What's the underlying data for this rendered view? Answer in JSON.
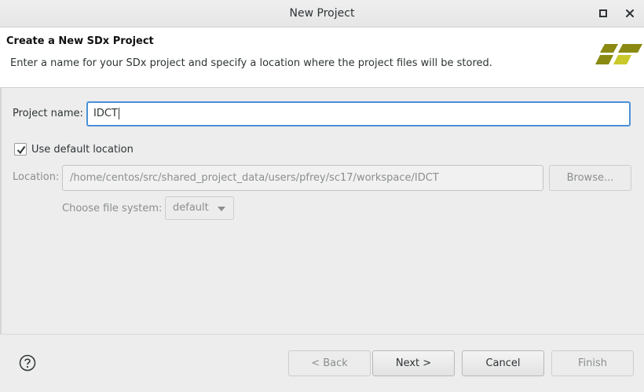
{
  "window": {
    "title": "New Project",
    "maximize_icon": "maximize-icon",
    "close_icon": "close-icon"
  },
  "header": {
    "title": "Create a New SDx Project",
    "description": "Enter a name for your SDx project and specify a location where the project files will be stored.",
    "logo_icon": "sdx-logo-icon"
  },
  "form": {
    "project_name_label": "Project name:",
    "project_name_value": "IDCT",
    "use_default_label": "Use default location",
    "use_default_checked": true,
    "location_label": "Location:",
    "location_value": "/home/centos/src/shared_project_data/users/pfrey/sc17/workspace/IDCT",
    "browse_label": "Browse...",
    "file_system_label": "Choose file system:",
    "file_system_value": "default"
  },
  "footer": {
    "help_icon": "help-icon",
    "back_label": "< Back",
    "next_label": "Next >",
    "cancel_label": "Cancel",
    "finish_label": "Finish"
  },
  "colors": {
    "focus_border": "#4a90d9",
    "logo_dark": "#8a8a12",
    "logo_light": "#c9c92a"
  }
}
